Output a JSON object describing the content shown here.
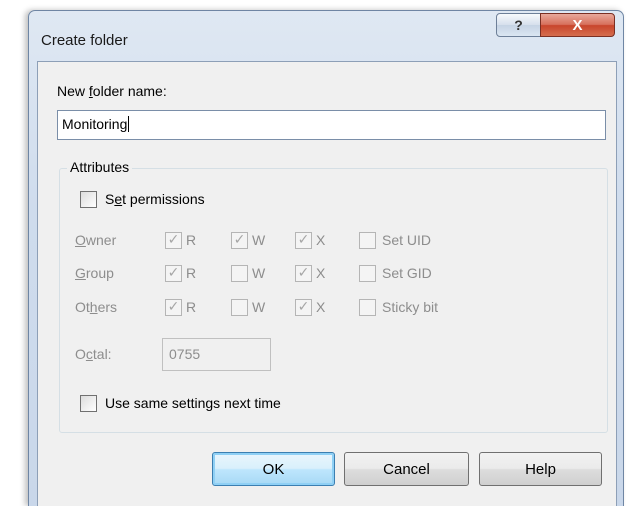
{
  "window": {
    "title": "Create folder",
    "help_glyph": "?",
    "close_glyph": "X"
  },
  "name_field": {
    "label_before": "New ",
    "label_mnemonic": "f",
    "label_after": "older name:",
    "value": "Monitoring"
  },
  "attributes": {
    "caption": "Attributes",
    "set_permissions": {
      "label_pre": "S",
      "label_mnemonic": "e",
      "label_post": "t permissions",
      "checked": false
    },
    "rows": [
      {
        "label_mnemonic": "O",
        "label_rest": "wner",
        "label_pre": "",
        "r": {
          "label": "R",
          "checked": true
        },
        "w": {
          "label": "W",
          "checked": true
        },
        "x": {
          "label": "X",
          "checked": true
        },
        "special": {
          "label": "Set UID",
          "checked": false
        }
      },
      {
        "label_mnemonic": "G",
        "label_rest": "roup",
        "label_pre": "",
        "r": {
          "label": "R",
          "checked": true
        },
        "w": {
          "label": "W",
          "checked": false
        },
        "x": {
          "label": "X",
          "checked": true
        },
        "special": {
          "label": "Set GID",
          "checked": false
        }
      },
      {
        "label_pre": "Ot",
        "label_mnemonic": "h",
        "label_rest": "ers",
        "r": {
          "label": "R",
          "checked": true
        },
        "w": {
          "label": "W",
          "checked": false
        },
        "x": {
          "label": "X",
          "checked": true
        },
        "special": {
          "label": "Sticky bit",
          "checked": false
        }
      }
    ],
    "octal": {
      "label_pre": "O",
      "label_mnemonic": "c",
      "label_rest": "tal:",
      "value": "0755"
    },
    "use_same": {
      "label": "Use same settings next time",
      "checked": false
    }
  },
  "buttons": {
    "ok": "OK",
    "cancel": "Cancel",
    "help": "Help"
  },
  "check_glyph": "✓"
}
